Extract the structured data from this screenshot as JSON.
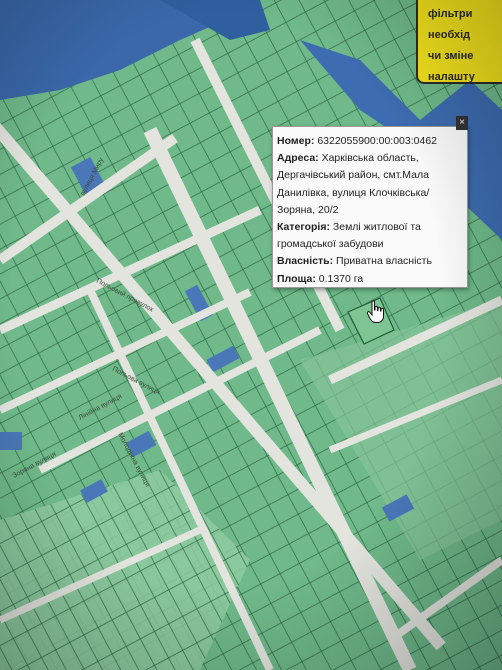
{
  "notice": {
    "lines": [
      "фільтри",
      "необхід",
      "чи зміне",
      "налашту"
    ]
  },
  "popup": {
    "number_label": "Номер:",
    "number_value": "6322055900:00:003:0462",
    "address_label": "Адреса:",
    "address_value": "Харківська область, Дергачівський район, смт.Мала Данилівка, вулиця Клочківська/Зоряна, 20/2",
    "category_label": "Категорія:",
    "category_value": "Землі житлової та громадської забудови",
    "ownership_label": "Власність:",
    "ownership_value": "Приватна власність",
    "area_label": "Площа:",
    "area_value": "0.1370 га",
    "close_label": "×"
  },
  "map": {
    "streets": [
      "вулиця Миру",
      "Польовий провулок",
      "Польова вулиця",
      "Лінійна вулиця",
      "Молодіжна вулиця",
      "Зоряна вулиця"
    ],
    "colors": {
      "private": "#5aa874",
      "communal": "#3f6fb0",
      "road": "#e4e4df",
      "outline": "#2e5e3e"
    }
  }
}
